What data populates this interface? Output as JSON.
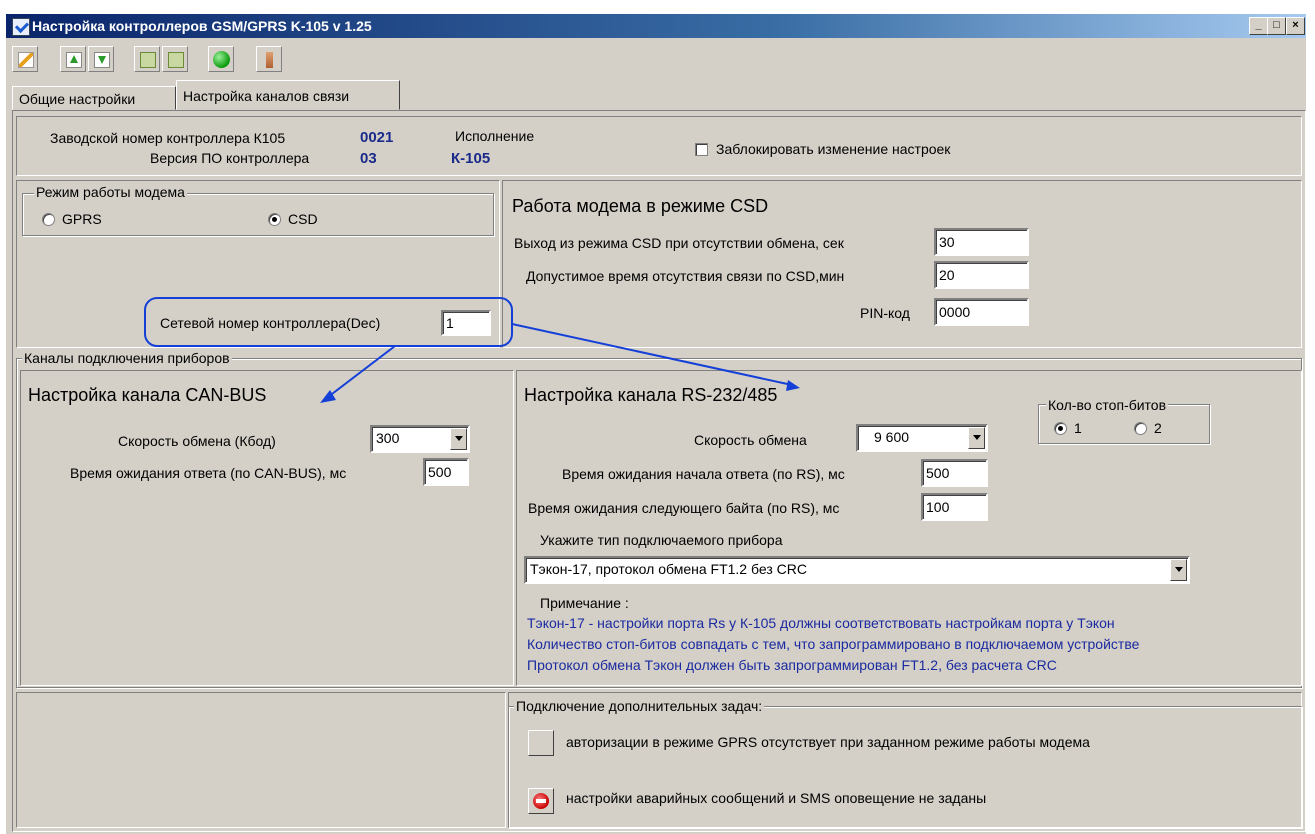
{
  "window": {
    "title": "Настройка контроллеров GSM/GPRS K-105   v 1.25",
    "min": "_",
    "max": "□",
    "close": "×"
  },
  "tabs": [
    {
      "label": "Общие настройки"
    },
    {
      "label": "Настройка каналов связи"
    }
  ],
  "header": {
    "serial_label": "Заводской номер контроллера К105",
    "serial_value": "0021",
    "fw_label": "Версия ПО контроллера",
    "fw_value": "03",
    "exec_label": "Исполнение",
    "exec_value": "К-105",
    "lock_label": "Заблокировать изменение настроек"
  },
  "modem_mode": {
    "legend": "Режим работы модема",
    "gprs": "GPRS",
    "csd": "CSD",
    "selected": "CSD"
  },
  "network": {
    "label": "Сетевой номер контроллера(Dec)",
    "value": "1"
  },
  "csd": {
    "title": "Работа модема в режиме CSD",
    "exit_label": "Выход из режима CSD при отсутствии обмена, сек",
    "exit_value": "30",
    "allowed_label": "Допустимое время отсутствия связи по CSD,мин",
    "allowed_value": "20",
    "pin_label": "PIN-код",
    "pin_value": "0000"
  },
  "channels": {
    "legend": "Каналы подключения приборов"
  },
  "can": {
    "title": "Настройка  канала CAN-BUS",
    "speed_label": "Скорость обмена (Кбод)",
    "speed_value": "300",
    "timeout_label": "Время ожидания ответа (по CAN-BUS), мс",
    "timeout_value": "500"
  },
  "rs": {
    "title": "Настройка канала RS-232/485",
    "stop_legend": "Кол-во стоп-битов",
    "stop_1": "1",
    "stop_2": "2",
    "speed_label": "Скорость обмена",
    "speed_value": "9 600",
    "start_label": "Время ожидания начала ответа (по RS), мс",
    "start_value": "500",
    "next_label": "Время ожидания следующего байта (по RS), мс",
    "next_value": "100",
    "device_label": "Укажите тип подключаемого прибора",
    "device_value": "Тэкон-17, протокол обмена FT1.2 без CRC",
    "note_label": "Примечание :",
    "note_1": "Тэкон-17 - настройки порта Rs у К-105 должны соответствовать настройкам порта у Тэкон",
    "note_2": "Количество стоп-битов совпадать с тем, что запрограммировано в подключаемом устройстве",
    "note_3": "Протокол обмена Тэкон должен быть запрограммирован FT1.2, без расчета CRC"
  },
  "tasks": {
    "legend": "Подключение дополнительных задач:",
    "auth_text": "авторизации в режиме GPRS отсутствует при заданном режиме работы модема",
    "alarm_text": "настройки аварийных сообщений и SMS оповещение не заданы"
  },
  "colors": {
    "accent_blue": "#1a2aa0",
    "annotation": "#1540d8"
  }
}
